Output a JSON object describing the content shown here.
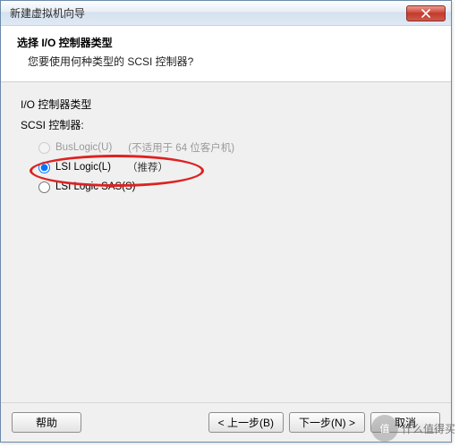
{
  "window": {
    "title": "新建虚拟机向导"
  },
  "header": {
    "title": "选择 I/O 控制器类型",
    "subtitle": "您要使用何种类型的 SCSI 控制器?"
  },
  "section": {
    "label1": "I/O 控制器类型",
    "label2": "SCSI 控制器:"
  },
  "options": {
    "buslogic": {
      "label": "BusLogic(U)",
      "hint": "(不适用于 64 位客户机)",
      "checked": false,
      "disabled": true
    },
    "lsilogic": {
      "label": "LSI Logic(L)",
      "hint": "（推荐）",
      "checked": true,
      "disabled": false
    },
    "lsisas": {
      "label": "LSI Logic SAS(S)",
      "hint": "",
      "checked": false,
      "disabled": false
    }
  },
  "buttons": {
    "help": "帮助",
    "back": "< 上一步(B)",
    "next": "下一步(N) >",
    "cancel": "取消"
  },
  "watermark": {
    "text": "什么值得买",
    "icon": "值"
  }
}
